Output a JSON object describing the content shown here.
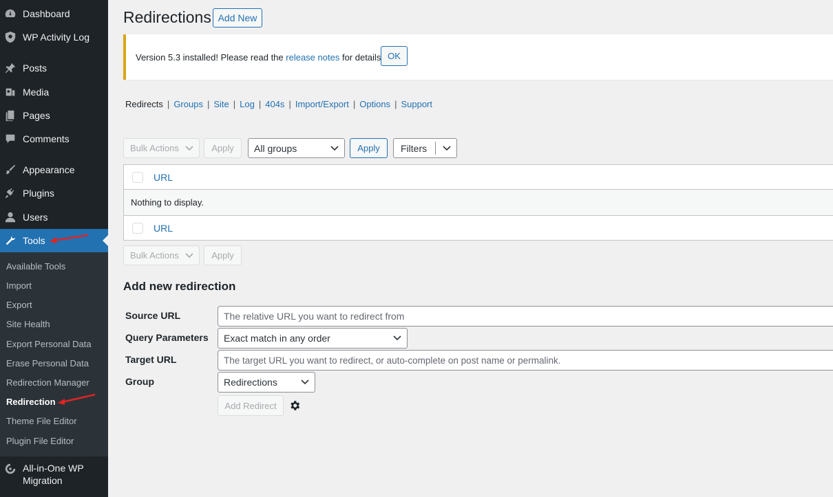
{
  "sidebar": {
    "items": [
      {
        "label": "Dashboard",
        "icon": "dashboard-icon"
      },
      {
        "label": "WP Activity Log",
        "icon": "shield-icon"
      },
      {
        "label": "Posts",
        "icon": "pushpin-icon"
      },
      {
        "label": "Media",
        "icon": "media-icon"
      },
      {
        "label": "Pages",
        "icon": "pages-icon"
      },
      {
        "label": "Comments",
        "icon": "comment-icon"
      },
      {
        "label": "Appearance",
        "icon": "paintbrush-icon"
      },
      {
        "label": "Plugins",
        "icon": "plugin-icon"
      },
      {
        "label": "Users",
        "icon": "user-icon"
      },
      {
        "label": "Tools",
        "icon": "wrench-icon"
      },
      {
        "label": "All-in-One WP",
        "label2": "Migration",
        "icon": "migration-icon"
      }
    ],
    "submenu": [
      "Available Tools",
      "Import",
      "Export",
      "Site Health",
      "Export Personal Data",
      "Erase Personal Data",
      "Redirection Manager",
      "Redirection",
      "Theme File Editor",
      "Plugin File Editor"
    ]
  },
  "header": {
    "title": "Redirections",
    "add_new": "Add New"
  },
  "notice": {
    "text_before": "Version 5.3 installed! Please read the",
    "link": "release notes",
    "text_after": "for details.",
    "ok": "OK"
  },
  "tabs": [
    "Redirects",
    "Groups",
    "Site",
    "Log",
    "404s",
    "Import/Export",
    "Options",
    "Support"
  ],
  "toolbar": {
    "bulk_actions": "Bulk Actions",
    "apply": "Apply",
    "group_select": "All groups",
    "apply_active": "Apply",
    "filters": "Filters"
  },
  "table": {
    "header": "URL",
    "empty": "Nothing to display.",
    "footer": "URL"
  },
  "bottom_toolbar": {
    "bulk_actions": "Bulk Actions",
    "apply": "Apply"
  },
  "form": {
    "title": "Add new redirection",
    "source_label": "Source URL",
    "source_placeholder": "The relative URL you want to redirect from",
    "query_label": "Query Parameters",
    "query_value": "Exact match in any order",
    "target_label": "Target URL",
    "target_placeholder": "The target URL you want to redirect, or auto-complete on post name or permalink.",
    "group_label": "Group",
    "group_value": "Redirections",
    "add_button": "Add Redirect"
  },
  "colors": {
    "sidebar": "#1d2327",
    "submenu": "#2c3338",
    "accent": "#2271b1",
    "notice_warning": "#dba617",
    "annotation_arrow": "#e02424"
  }
}
